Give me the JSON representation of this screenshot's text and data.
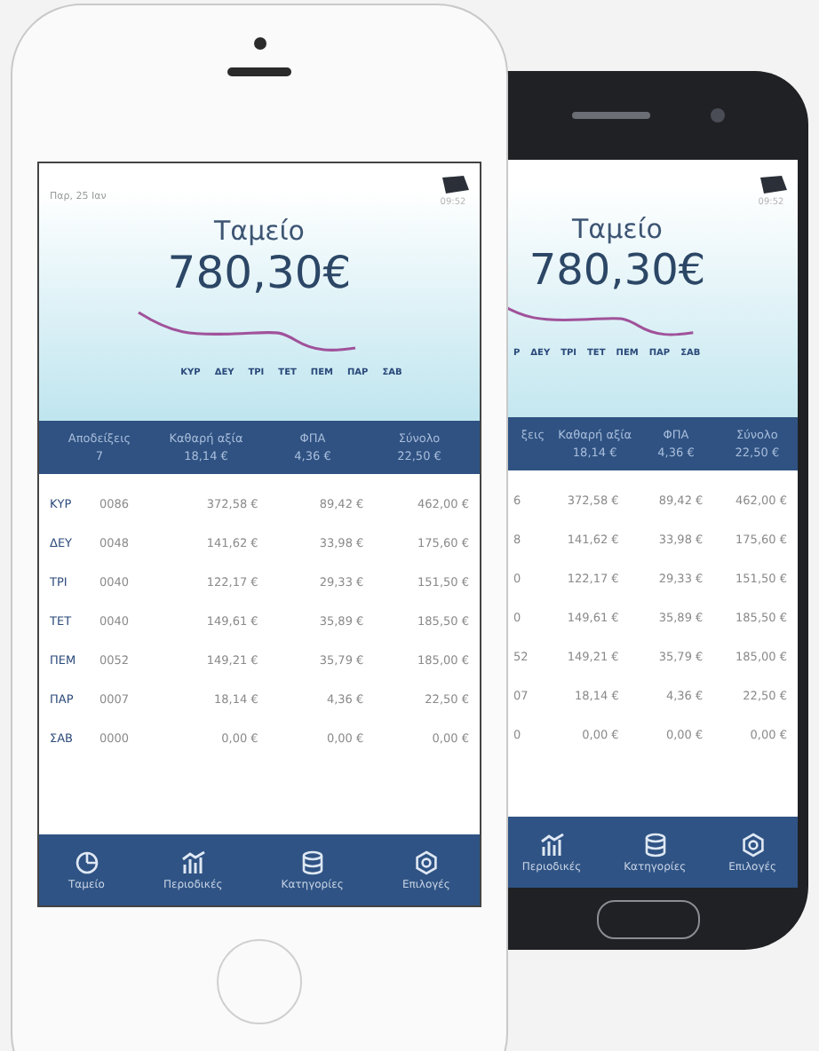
{
  "front_phone": {
    "date": "Παρ, 25 Ιαν",
    "time": "09:52",
    "title": "Ταμείο",
    "total": "780,30€",
    "days": [
      "ΚΥΡ",
      "ΔΕΥ",
      "ΤΡΙ",
      "ΤΕΤ",
      "ΠΕΜ",
      "ΠΑΡ",
      "ΣΑΒ"
    ],
    "summary": [
      {
        "label": "Αποδείξεις",
        "value": "7"
      },
      {
        "label": "Καθαρή αξία",
        "value": "18,14 €"
      },
      {
        "label": "ΦΠΑ",
        "value": "4,36 €"
      },
      {
        "label": "Σύνολο",
        "value": "22,50 €"
      }
    ],
    "rows": [
      {
        "day": "ΚΥΡ",
        "receipts": "0086",
        "net": "372,58 €",
        "vat": "89,42 €",
        "total": "462,00 €"
      },
      {
        "day": "ΔΕΥ",
        "receipts": "0048",
        "net": "141,62 €",
        "vat": "33,98 €",
        "total": "175,60 €"
      },
      {
        "day": "ΤΡΙ",
        "receipts": "0040",
        "net": "122,17 €",
        "vat": "29,33 €",
        "total": "151,50 €"
      },
      {
        "day": "ΤΕΤ",
        "receipts": "0040",
        "net": "149,61 €",
        "vat": "35,89 €",
        "total": "185,50 €"
      },
      {
        "day": "ΠΕΜ",
        "receipts": "0052",
        "net": "149,21 €",
        "vat": "35,79 €",
        "total": "185,00 €"
      },
      {
        "day": "ΠΑΡ",
        "receipts": "0007",
        "net": "18,14 €",
        "vat": "4,36 €",
        "total": "22,50 €"
      },
      {
        "day": "ΣΑΒ",
        "receipts": "0000",
        "net": "0,00 €",
        "vat": "0,00 €",
        "total": "0,00 €"
      }
    ],
    "tabs": [
      {
        "label": "Ταμείο",
        "kind": "pie"
      },
      {
        "label": "Περιοδικές",
        "kind": "bars"
      },
      {
        "label": "Κατηγορίες",
        "kind": "stack"
      },
      {
        "label": "Επιλογές",
        "kind": "gear"
      }
    ]
  },
  "back_phone": {
    "time": "09:52",
    "title": "Ταμείο",
    "total": "780,30€",
    "days": [
      "Ρ",
      "ΔΕΥ",
      "ΤΡΙ",
      "ΤΕΤ",
      "ΠΕΜ",
      "ΠΑΡ",
      "ΣΑΒ"
    ],
    "summary": [
      {
        "label": "ξεις"
      },
      {
        "label": "Καθαρή αξία",
        "value": "18,14 €"
      },
      {
        "label": "ΦΠΑ",
        "value": "4,36 €"
      },
      {
        "label": "Σύνολο",
        "value": "22,50 €"
      }
    ],
    "rows": [
      {
        "receipts": "6",
        "net": "372,58 €",
        "vat": "89,42 €",
        "total": "462,00 €"
      },
      {
        "receipts": "8",
        "net": "141,62 €",
        "vat": "33,98 €",
        "total": "175,60 €"
      },
      {
        "receipts": "0",
        "net": "122,17 €",
        "vat": "29,33 €",
        "total": "151,50 €"
      },
      {
        "receipts": "0",
        "net": "149,61 €",
        "vat": "35,89 €",
        "total": "185,50 €"
      },
      {
        "receipts": "52",
        "net": "149,21 €",
        "vat": "35,79 €",
        "total": "185,00 €"
      },
      {
        "receipts": "07",
        "net": "18,14 €",
        "vat": "4,36 €",
        "total": "22,50 €"
      },
      {
        "receipts": "0",
        "net": "0,00 €",
        "vat": "0,00 €",
        "total": "0,00 €"
      }
    ],
    "tabs": [
      {
        "label": "Περιοδικές",
        "kind": "bars"
      },
      {
        "label": "Κατηγορίες",
        "kind": "stack"
      },
      {
        "label": "Επιλογές",
        "kind": "gear"
      }
    ]
  }
}
